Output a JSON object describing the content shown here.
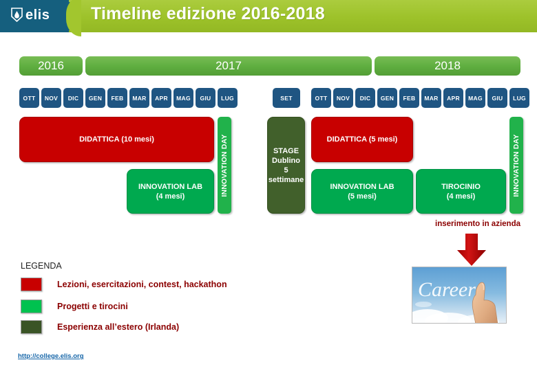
{
  "header": {
    "logo_text": "elis",
    "logo_icon": "elis-diamond-logo",
    "title": "Timeline edizione 2016-2018"
  },
  "timeline": {
    "years": [
      {
        "label": "2016"
      },
      {
        "label": "2017"
      },
      {
        "label": "2018"
      }
    ],
    "months_2016_2017": [
      "OTT",
      "NOV",
      "DIC",
      "GEN",
      "FEB",
      "MAR",
      "APR",
      "MAG",
      "GIU",
      "LUG"
    ],
    "month_set": "SET",
    "months_2018": [
      "OTT",
      "NOV",
      "DIC",
      "GEN",
      "FEB",
      "MAR",
      "APR",
      "MAG",
      "GIU",
      "LUG"
    ],
    "blocks": [
      {
        "id": "didattica-10",
        "text": "DIDATTICA (10 mesi)",
        "color": "#c80000"
      },
      {
        "id": "innovation-lab-4",
        "line1": "INNOVATION LAB",
        "line2": "(4 mesi)",
        "color": "#00a94f"
      },
      {
        "id": "innovation-day-1",
        "text": "INNOVATION DAY",
        "color": "#21b24b"
      },
      {
        "id": "stage-dublino",
        "line1": "STAGE",
        "line2": "Dublino",
        "line3": "5",
        "line4": "settimane",
        "color": "#41602b"
      },
      {
        "id": "didattica-5",
        "text": "DIDATTICA (5 mesi)",
        "color": "#c80000"
      },
      {
        "id": "innovation-lab-5",
        "line1": "INNOVATION LAB",
        "line2": "(5 mesi)",
        "color": "#00a94f"
      },
      {
        "id": "tirocinio-4",
        "line1": "TIROCINIO",
        "line2": "(4 mesi)",
        "color": "#00a94f"
      },
      {
        "id": "innovation-day-2",
        "text": "INNOVATION DAY",
        "color": "#21b24b"
      }
    ]
  },
  "annotations": {
    "insertion_text": "inserimento in azienda",
    "arrow_icon": "down-arrow-icon",
    "career_image_word": "Career",
    "career_image_alt": "career-sky-hand-image"
  },
  "legend": {
    "title": "LEGENDA",
    "items": [
      {
        "color": "#c80000",
        "label": "Lezioni, esercitazioni, contest, hackathon"
      },
      {
        "color": "#00c24f",
        "label": "Progetti  e tirocini"
      },
      {
        "color": "#3a5426",
        "label": "Esperienza all’estero (Irlanda)"
      }
    ]
  },
  "footer": {
    "link": "http://college.elis.org"
  }
}
